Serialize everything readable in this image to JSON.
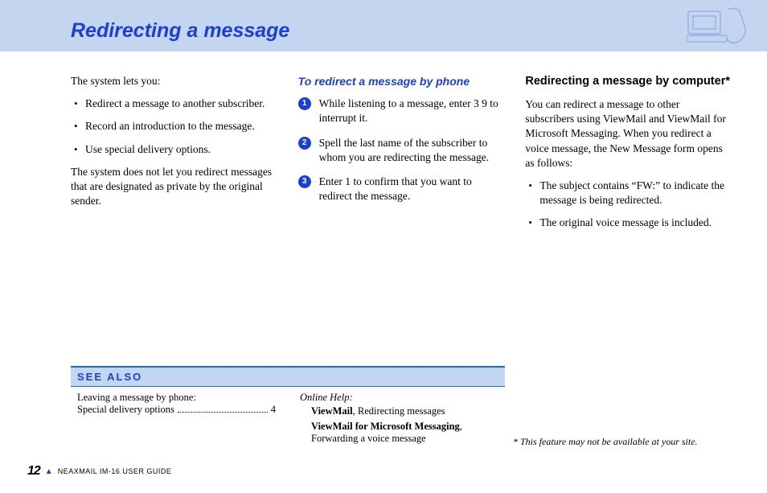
{
  "title": "Redirecting a message",
  "intro": {
    "lead": "The system lets you:",
    "bullets": [
      "Redirect a message to another subscriber.",
      "Record an introduction to the message.",
      "Use special delivery options."
    ],
    "note": "The system does not let you redirect messages that are designated as private by the original sender."
  },
  "by_phone": {
    "heading": "To redirect a message by phone",
    "steps": [
      "While listening to a message, enter 3 9 to interrupt it.",
      "Spell the last name of the subscriber to whom you are redirecting the message.",
      "Enter 1 to confirm that you want to redirect the message."
    ]
  },
  "by_computer": {
    "heading": "Redirecting a message by computer*",
    "lead": "You can redirect a message to other subscribers using ViewMail and ViewMail for Microsoft Messaging. When you redirect a voice message, the New Message form opens as follows:",
    "bullets": [
      "The subject contains “FW:” to indicate the message is being redirected.",
      "The original voice message is included."
    ]
  },
  "see_also": {
    "heading": "SEE ALSO",
    "left": {
      "line1": "Leaving a message by phone:",
      "line2_label": "Special delivery options",
      "line2_page": "4"
    },
    "right": {
      "lead": "Online Help:",
      "item1_bold": "ViewMail",
      "item1_rest": ", Redirecting messages",
      "item2_bold": "ViewMail for Microsoft Messaging",
      "item2_rest": ", Forwarding a voice message"
    }
  },
  "footnote": "* This feature may not be available at your site.",
  "footer": {
    "page_number": "12",
    "guide": "NEAXMAIL IM-16 USER GUIDE"
  }
}
